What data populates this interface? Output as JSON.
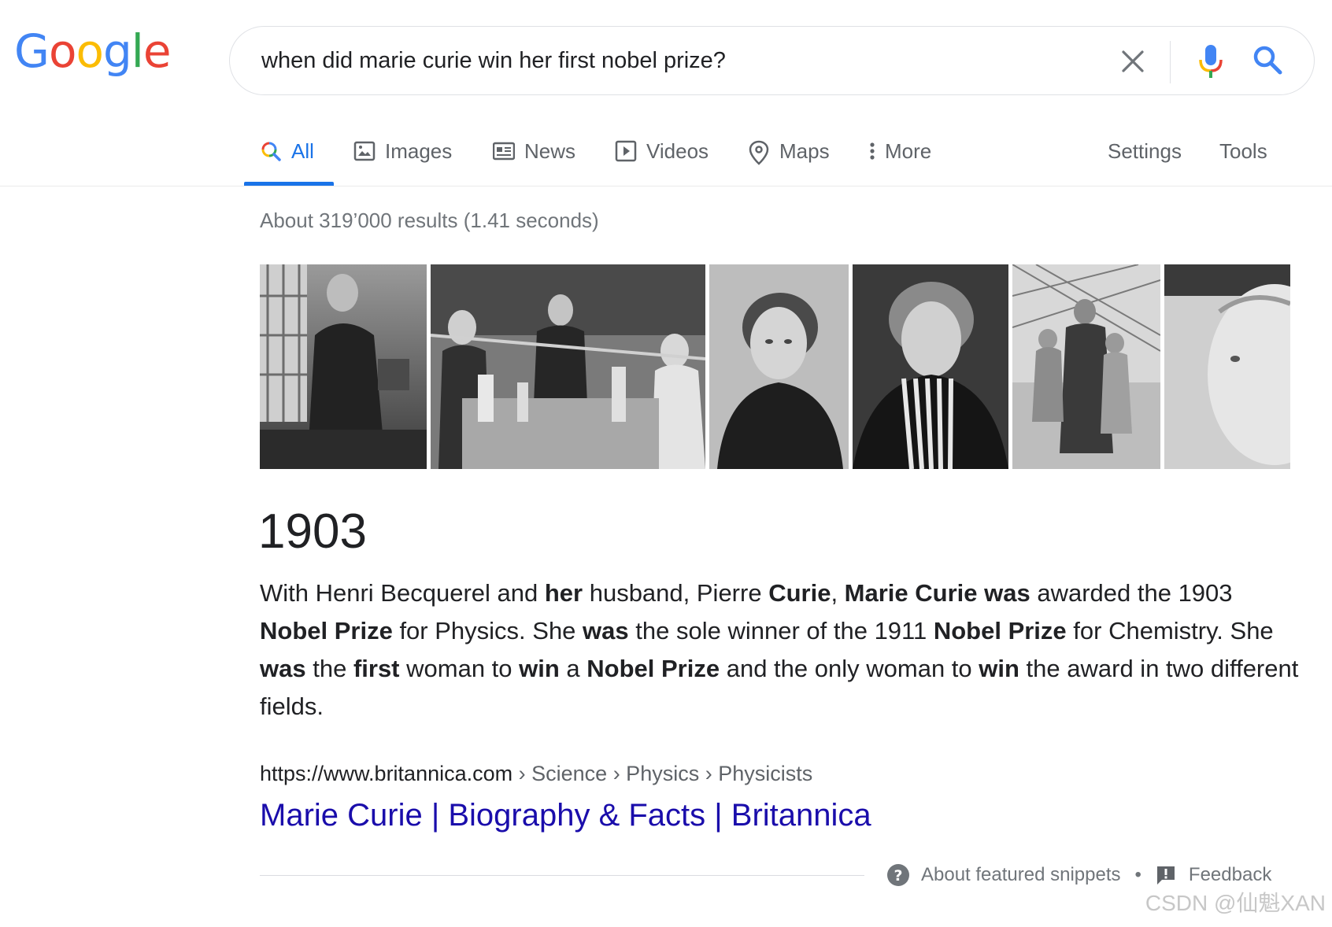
{
  "logo": {
    "letters": [
      "G",
      "o",
      "o",
      "g",
      "l",
      "e"
    ],
    "colors": [
      "#4285F4",
      "#EA4335",
      "#FBBC05",
      "#4285F4",
      "#34A853",
      "#EA4335"
    ]
  },
  "search": {
    "query": "when did marie curie win her first nobel prize?"
  },
  "icons": {
    "clear": "close-icon",
    "mic": "mic-icon",
    "search": "search-icon",
    "all": "search-icon",
    "images": "image-icon",
    "news": "newspaper-icon",
    "videos": "play-icon",
    "maps": "map-pin-icon",
    "more": "kebab-icon",
    "help": "question-circle-icon",
    "feedback": "feedback-icon"
  },
  "tabs": {
    "all": "All",
    "images": "Images",
    "news": "News",
    "videos": "Videos",
    "maps": "Maps",
    "more": "More",
    "settings": "Settings",
    "tools": "Tools"
  },
  "stats": "About 319’000 results (1.41 seconds)",
  "answer": {
    "title": "1903",
    "snippet": [
      {
        "t": "With Henri Becquerel and ",
        "b": false
      },
      {
        "t": "her",
        "b": true
      },
      {
        "t": " husband, Pierre ",
        "b": false
      },
      {
        "t": "Curie",
        "b": true
      },
      {
        "t": ", ",
        "b": false
      },
      {
        "t": "Marie Curie was",
        "b": true
      },
      {
        "t": " awarded the 1903 ",
        "b": false
      },
      {
        "t": "Nobel Prize",
        "b": true
      },
      {
        "t": " for Physics. She ",
        "b": false
      },
      {
        "t": "was",
        "b": true
      },
      {
        "t": " the sole winner of the 1911 ",
        "b": false
      },
      {
        "t": "Nobel Prize",
        "b": true
      },
      {
        "t": " for Chemistry. She ",
        "b": false
      },
      {
        "t": "was",
        "b": true
      },
      {
        "t": " the ",
        "b": false
      },
      {
        "t": "first",
        "b": true
      },
      {
        "t": " woman to ",
        "b": false
      },
      {
        "t": "win",
        "b": true
      },
      {
        "t": " a ",
        "b": false
      },
      {
        "t": "Nobel Prize",
        "b": true
      },
      {
        "t": " and the only woman to ",
        "b": false
      },
      {
        "t": "win",
        "b": true
      },
      {
        "t": " the award in two different fields.",
        "b": false
      }
    ]
  },
  "source": {
    "url": "https://www.britannica.com",
    "breadcrumbs": " › Science › Physics › Physicists",
    "title": "Marie Curie | Biography & Facts | Britannica"
  },
  "footer": {
    "about": "About featured snippets",
    "separator": "•",
    "feedback": "Feedback"
  },
  "watermark": "CSDN @仙魁XAN"
}
